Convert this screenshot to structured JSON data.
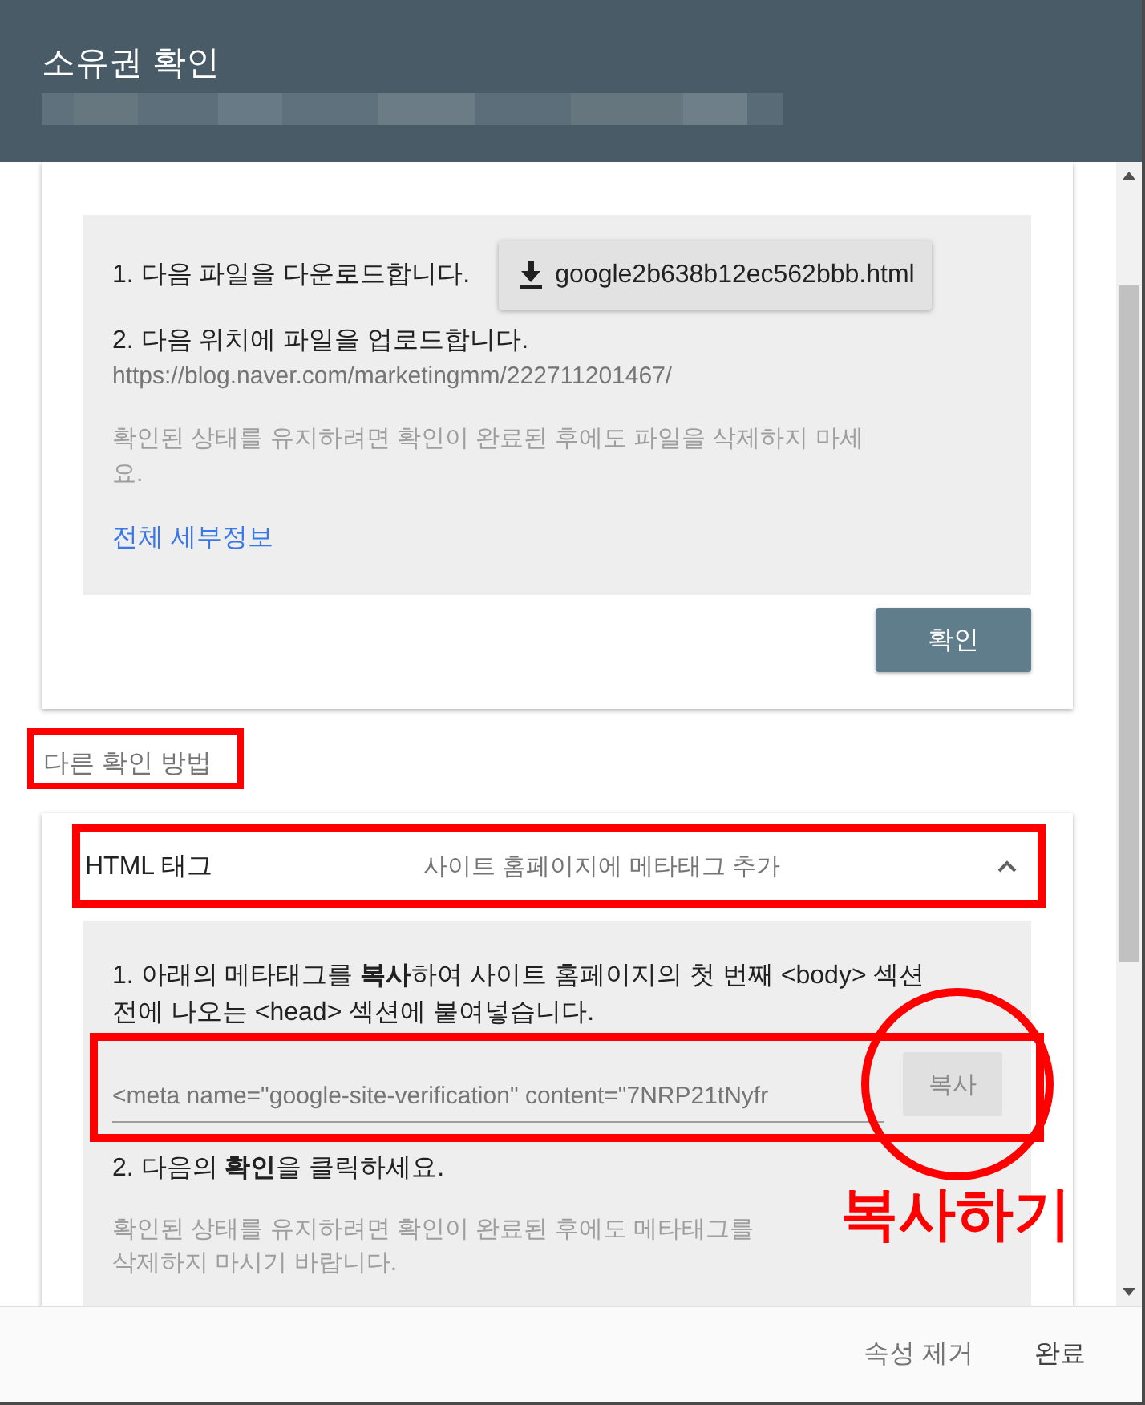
{
  "dialog": {
    "title": "소유권 확인"
  },
  "file_method": {
    "download_step": "1. 다음 파일을 다운로드합니다.",
    "download_button": "google2b638b12ec562bbb.html",
    "upload_step": "2. 다음 위치에 파일을 업로드합니다.",
    "upload_url": "https://blog.naver.com/marketingmm/222711201467/",
    "note": "확인된 상태를 유지하려면 확인이 완료된 후에도 파일을 삭제하지 마세요.",
    "details_link": "전체 세부정보",
    "confirm_button": "확인"
  },
  "other_methods": {
    "heading": "다른 확인 방법",
    "highlighted": true
  },
  "html_tag_method": {
    "title": "HTML 태그",
    "description": "사이트 홈페이지에 메타태그 추가",
    "expanded": true,
    "header_highlighted": true,
    "step_1": "1. 아래의 메타태그를 **복사**하여 사이트 홈페이지의 첫 번째 <body> 섹션 전에 나오는 <head> 섹션에 붙여넣습니다.",
    "meta_field": {
      "value": "<meta name=\"google-site-verification\" content=\"7NRP21tNyfr",
      "highlighted": true
    },
    "copy_button": {
      "label": "복사",
      "circled": true,
      "callout": "복사하기"
    },
    "step_2": "2. 다음의 **확인**을 클릭하세요.",
    "note": "확인된 상태를 유지하려면 확인이 완료된 후에도 메타태그를 삭제하지 마시기 바랍니다."
  },
  "footer": {
    "buttons": [
      {
        "label": "속성 제거",
        "kind": "secondary"
      },
      {
        "label": "완료",
        "kind": "primary"
      }
    ]
  }
}
